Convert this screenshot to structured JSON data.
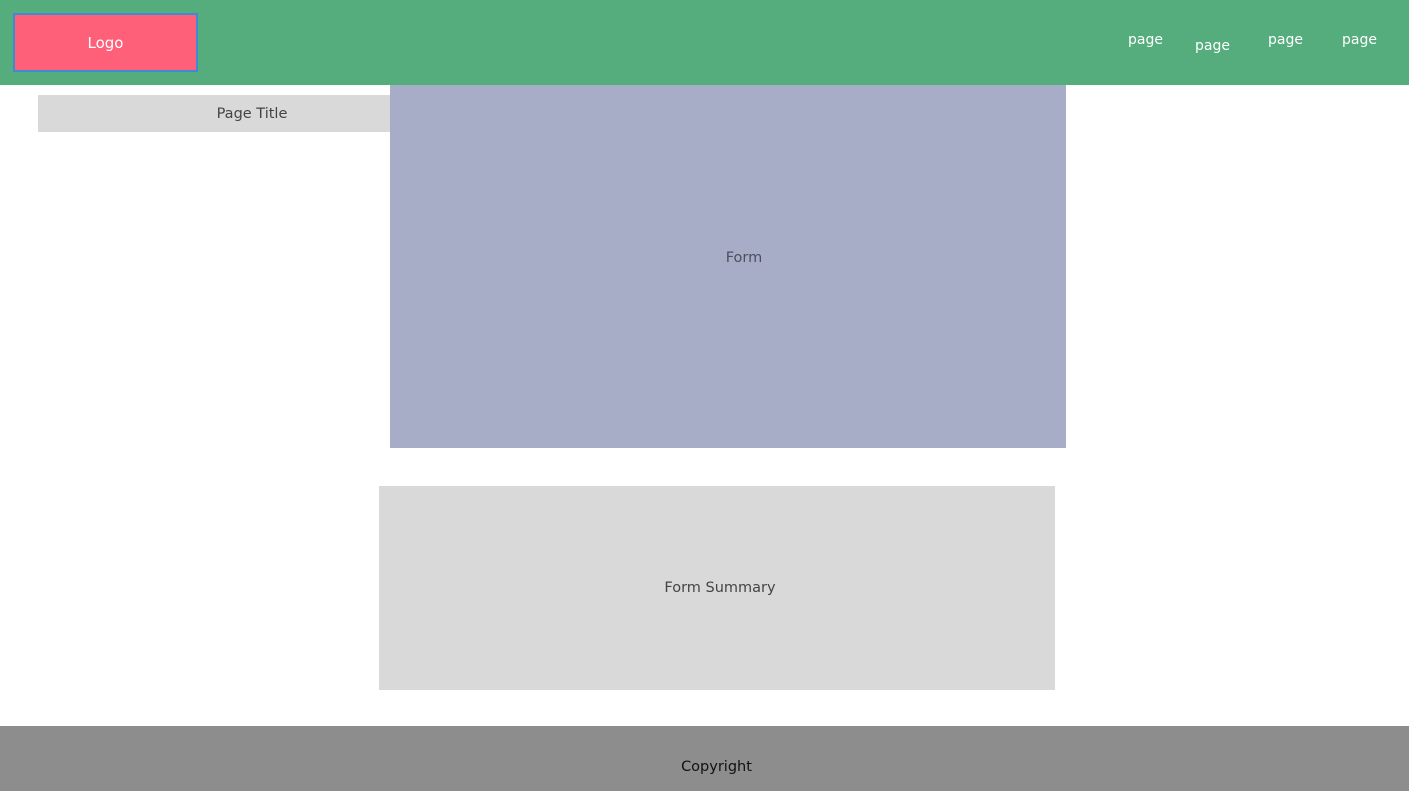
{
  "header": {
    "logo_label": "Logo",
    "nav": [
      {
        "label": "page"
      },
      {
        "label": "page"
      },
      {
        "label": "page"
      },
      {
        "label": "page"
      }
    ]
  },
  "main": {
    "page_title": "Page Title",
    "form_label": "Form",
    "form_summary_label": "Form Summary"
  },
  "footer": {
    "copyright": "Copyright"
  },
  "colors": {
    "header_bg": "#55ad7d",
    "logo_bg": "#ff6079",
    "logo_border": "#3e8ad4",
    "placeholder_gray": "#d9d9d9",
    "form_bg": "#a8adc7",
    "footer_bg": "#8d8d8d"
  }
}
